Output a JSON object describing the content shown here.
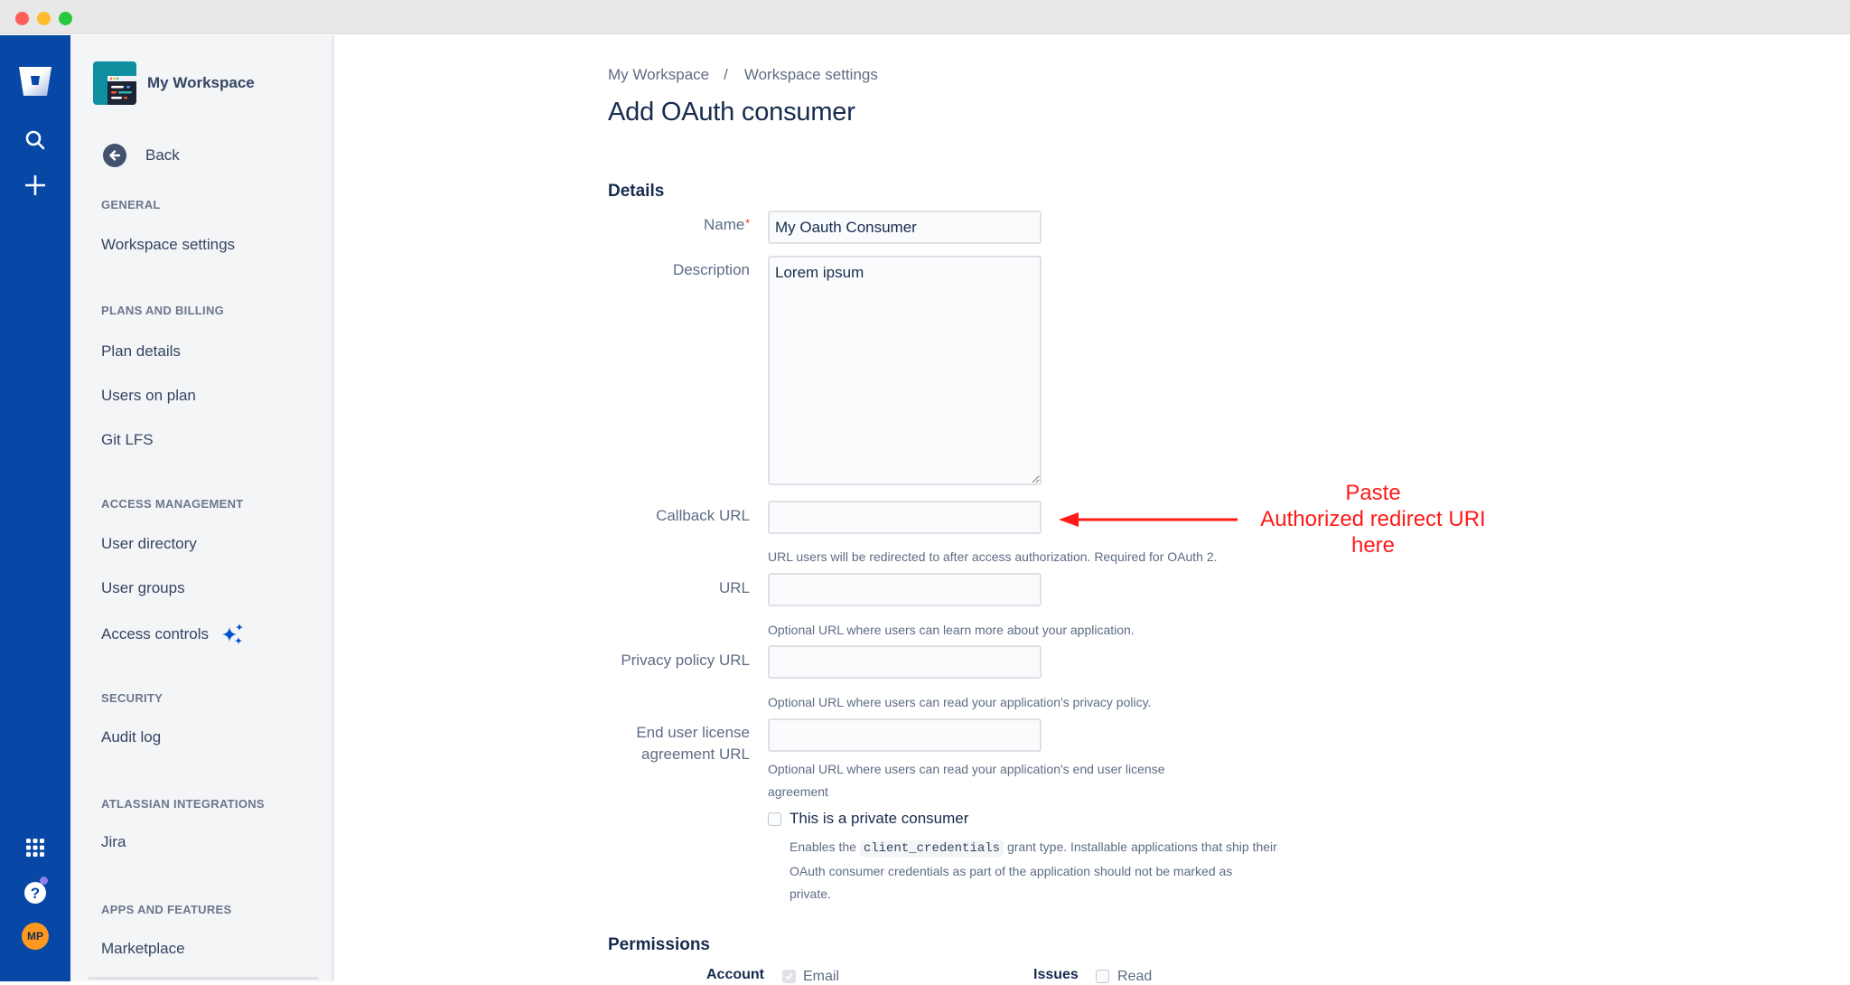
{
  "window": {
    "controls": [
      "close",
      "minimize",
      "zoom"
    ]
  },
  "rail": {
    "top_icons": [
      "bitbucket-logo-icon",
      "search-icon",
      "create-plus-icon"
    ],
    "bottom_icons": [
      "app-switcher-grid-icon",
      "help-icon",
      "profile-avatar"
    ],
    "avatar_initials": "MP",
    "avatar_color": "#ff991f",
    "rail_color": "#0747a6"
  },
  "sidebar": {
    "workspace_name": "My Workspace",
    "back_label": "Back",
    "sections": [
      {
        "title": "GENERAL",
        "items": [
          "Workspace settings"
        ]
      },
      {
        "title": "PLANS AND BILLING",
        "items": [
          "Plan details",
          "Users on plan",
          "Git LFS"
        ]
      },
      {
        "title": "ACCESS MANAGEMENT",
        "items": [
          "User directory",
          "User groups",
          "Access controls"
        ]
      },
      {
        "title": "SECURITY",
        "items": [
          "Audit log"
        ]
      },
      {
        "title": "ATLASSIAN INTEGRATIONS",
        "items": [
          "Jira"
        ]
      },
      {
        "title": "APPS AND FEATURES",
        "items": [
          "Marketplace"
        ]
      }
    ],
    "access_controls_badge_icon": "sparkle-icon"
  },
  "main": {
    "breadcrumb": [
      "My Workspace",
      "Workspace settings"
    ],
    "breadcrumb_separator": "/",
    "title": "Add OAuth consumer",
    "details_heading": "Details",
    "fields": {
      "name": {
        "label": "Name",
        "required_mark": "*",
        "value": "My Oauth Consumer"
      },
      "description": {
        "label": "Description",
        "value": "Lorem ipsum"
      },
      "callback_url": {
        "label": "Callback URL",
        "value": "",
        "help": "URL users will be redirected to after access authorization. Required for OAuth 2."
      },
      "url": {
        "label": "URL",
        "value": "",
        "help": "Optional URL where users can learn more about your application."
      },
      "privacy_url": {
        "label": "Privacy policy URL",
        "value": "",
        "help": "Optional URL where users can read your application's privacy policy."
      },
      "eula_url": {
        "label_line1": "End user license",
        "label_line2": "agreement URL",
        "value": "",
        "help": "Optional URL where users can read your application's end user license agreement"
      }
    },
    "private_consumer": {
      "label": "This is a private consumer",
      "checked": false,
      "help_prefix": "Enables the",
      "help_code": "client_credentials",
      "help_suffix": "grant type. Installable applications that ship their OAuth consumer credentials as part of the application should not be marked as private."
    },
    "permissions": {
      "heading": "Permissions",
      "groups": [
        {
          "label": "Account",
          "options": [
            {
              "label": "Email",
              "checked": true,
              "disabled": true
            }
          ]
        },
        {
          "label": "Issues",
          "options": [
            {
              "label": "Read",
              "checked": false,
              "disabled": false
            }
          ]
        }
      ]
    }
  },
  "annotation": {
    "lines": [
      "Paste",
      "Authorized redirect URI",
      "here"
    ],
    "color": "#ff1a1a"
  }
}
